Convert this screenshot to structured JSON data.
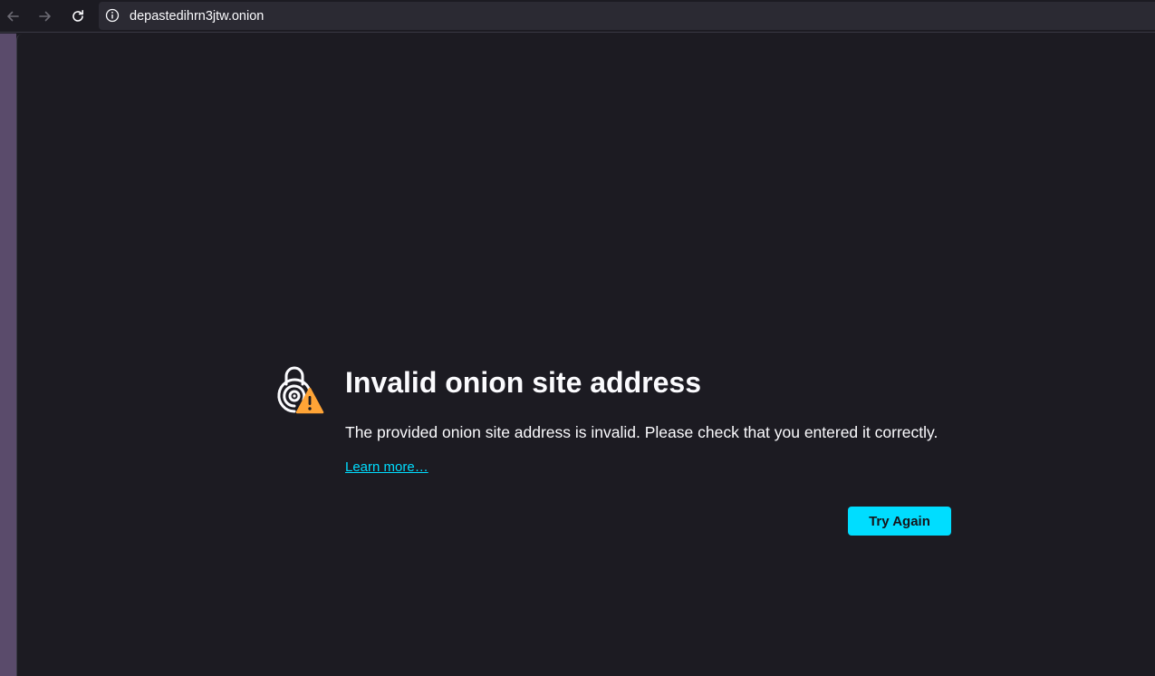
{
  "browser": {
    "url": "depastedihrn3jtw.onion",
    "icons": {
      "back": "arrow-left-icon",
      "forward": "arrow-right-icon",
      "reload": "reload-icon",
      "site_info": "info-circle-icon"
    }
  },
  "error_page": {
    "icon": "onion-lock-warning-icon",
    "title": "Invalid onion site address",
    "description": "The provided onion site address is invalid. Please check that you entered it correctly.",
    "learn_more_label": "Learn more…",
    "try_again_label": "Try Again"
  },
  "colors": {
    "background": "#1c1b22",
    "accent": "#00ddff",
    "warning": "#ffa436",
    "text": "#fbfbfe",
    "sidebar": "#5a4b6b"
  }
}
